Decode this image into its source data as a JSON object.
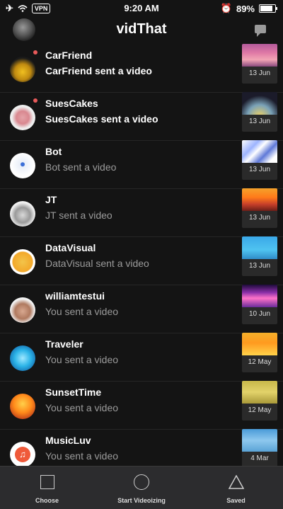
{
  "status_bar": {
    "time": "9:20 AM",
    "vpn": "VPN",
    "battery": "89%"
  },
  "header": {
    "title": "vidThat",
    "avatar_icon": "profile-avatar",
    "chat_icon": "chat-icon"
  },
  "conversations": [
    {
      "name": "CarFriend",
      "subtitle": "CarFriend sent a video",
      "date": "13 Jun",
      "unread": true
    },
    {
      "name": "SuesCakes",
      "subtitle": "SuesCakes sent a video",
      "date": "13 Jun",
      "unread": true
    },
    {
      "name": "Bot",
      "subtitle": "Bot sent a video",
      "date": "13 Jun",
      "unread": false
    },
    {
      "name": "JT",
      "subtitle": "JT sent a video",
      "date": "13 Jun",
      "unread": false
    },
    {
      "name": "DataVisual",
      "subtitle": "DataVisual sent a video",
      "date": "13 Jun",
      "unread": false
    },
    {
      "name": "williamtestui",
      "subtitle": "You sent a video",
      "date": "10 Jun",
      "unread": false
    },
    {
      "name": "Traveler",
      "subtitle": "You sent a video",
      "date": "12 May",
      "unread": false
    },
    {
      "name": "SunsetTime",
      "subtitle": "You sent a video",
      "date": "12 May",
      "unread": false
    },
    {
      "name": "MusicLuv",
      "subtitle": "You sent a video",
      "date": "4 Mar",
      "unread": false
    }
  ],
  "tabs": [
    {
      "label": "Choose",
      "icon": "square-icon"
    },
    {
      "label": "Start Videoizing",
      "icon": "circle-icon"
    },
    {
      "label": "Saved",
      "icon": "triangle-icon"
    }
  ],
  "colors": {
    "background": "#141414",
    "unread_dot": "#e85a5a",
    "tabbar": "#2c2c2e"
  }
}
